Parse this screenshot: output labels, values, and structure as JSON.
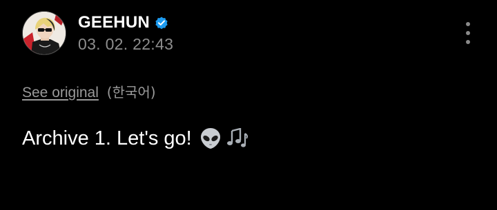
{
  "post": {
    "author": {
      "name": "GEEHUN",
      "verified": true
    },
    "timestamp": "03. 02. 22:43",
    "translation": {
      "see_original_label": "See original",
      "language_label": "(한국어)"
    },
    "body_text": "Archive 1. Let's go!",
    "emojis": [
      "alien-icon",
      "musical-notes-icon"
    ]
  },
  "icons": {
    "verified": "verified-badge-icon",
    "more": "more-vertical-icon"
  },
  "colors": {
    "background": "#000000",
    "verified_badge": "#1d9bf0",
    "secondary_text": "#8e8e8e"
  }
}
